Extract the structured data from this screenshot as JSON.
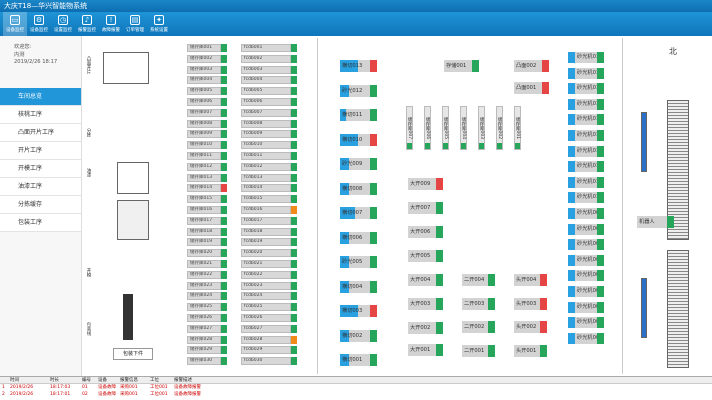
{
  "title": "大庆T18—华兴智能物系统",
  "toolbar": [
    {
      "label": "设备监控",
      "icon": "monitor-icon",
      "active": true
    },
    {
      "label": "设备监控",
      "icon": "gear-icon"
    },
    {
      "label": "设置监控",
      "icon": "clock-icon"
    },
    {
      "label": "报警监控",
      "icon": "bell-icon"
    },
    {
      "label": "故障报警",
      "icon": "alert-icon"
    },
    {
      "label": "订单管理",
      "icon": "document-icon"
    },
    {
      "label": "系统设置",
      "icon": "settings-icon"
    }
  ],
  "user": {
    "name_label": "欢迎您:",
    "name": "内测",
    "datetime": "2019/2/26  18:17"
  },
  "menu": [
    "车间总览",
    "核桃工序",
    "凸面开片工序",
    "开片工序",
    "开模工序",
    "油漆工序",
    "分拣缓存",
    "包装工序"
  ],
  "panel1_col1": [
    "储存库001",
    "储存库002",
    "储存库003",
    "储存库004",
    "储存库005",
    "储存库006",
    "储存库007",
    "储存库008",
    "储存库009",
    "储存库010",
    "储存库011",
    "储存库012",
    "储存库013",
    "储存库014",
    "储存库015",
    "储存库016",
    "储存库017",
    "储存库018",
    "储存库019",
    "储存库020",
    "储存库021",
    "储存库022",
    "储存库023",
    "储存库024",
    "储存库025",
    "储存库026",
    "储存库027",
    "储存库028",
    "储存库029",
    "储存库030"
  ],
  "panel1_col1_status": [
    "green",
    "green",
    "green",
    "green",
    "green",
    "green",
    "green",
    "green",
    "green",
    "green",
    "green",
    "green",
    "green",
    "red",
    "green",
    "green",
    "green",
    "green",
    "green",
    "green",
    "green",
    "green",
    "green",
    "green",
    "green",
    "green",
    "green",
    "green",
    "green",
    "green"
  ],
  "panel1_col2": [
    "fcdb001",
    "fcdb002",
    "fcdb003",
    "fcdb004",
    "fcdb005",
    "fcdb006",
    "fcdb007",
    "fcdb008",
    "fcdb009",
    "fcdb010",
    "fcdb011",
    "fcdb012",
    "fcdb013",
    "fcdb014",
    "fcdb015",
    "fcdb016",
    "fcdb017",
    "fcdb018",
    "fcdb019",
    "fcdb020",
    "fcdb021",
    "fcdb022",
    "fcdb023",
    "fcdb024",
    "fcdb025",
    "fcdb026",
    "fcdb027",
    "fcdb028",
    "fcdb029",
    "fcdb030"
  ],
  "panel1_col2_status": [
    "green",
    "green",
    "green",
    "green",
    "green",
    "green",
    "green",
    "green",
    "green",
    "green",
    "green",
    "green",
    "green",
    "green",
    "green",
    "orange",
    "green",
    "green",
    "green",
    "green",
    "green",
    "green",
    "green",
    "green",
    "green",
    "green",
    "green",
    "orange",
    "green",
    "green"
  ],
  "panel1_labels": {
    "bottom": "包装下件",
    "v1": "凸面开片",
    "v2": "分拣",
    "v3": "油漆",
    "v4": "开模",
    "v5": "包装线"
  },
  "panel2_left": [
    {
      "label": "横切013",
      "fill": 0.6,
      "status": "red"
    },
    {
      "label": "砂光012",
      "fill": 0.3,
      "status": "green"
    },
    {
      "label": "横切011",
      "fill": 0.2,
      "status": "green"
    },
    {
      "label": "横切010",
      "fill": 0.6,
      "status": "red"
    },
    {
      "label": "砂光009",
      "fill": 0.3,
      "status": "green"
    },
    {
      "label": "横切008",
      "fill": 0.3,
      "status": "green"
    },
    {
      "label": "横切007",
      "fill": 0.5,
      "status": "green"
    },
    {
      "label": "横切006",
      "fill": 0.3,
      "status": "green"
    },
    {
      "label": "砂光005",
      "fill": 0.3,
      "status": "green"
    },
    {
      "label": "横切004",
      "fill": 0.3,
      "status": "green"
    },
    {
      "label": "横切003",
      "fill": 0.6,
      "status": "red"
    },
    {
      "label": "横切002",
      "fill": 0.3,
      "status": "green"
    },
    {
      "label": "横切001",
      "fill": 0.3,
      "status": "green"
    }
  ],
  "panel2_top": [
    {
      "label": "存储001",
      "status": "green"
    },
    {
      "label": "凸面002",
      "status": "red"
    },
    {
      "label": "凸面001",
      "status": "red"
    }
  ],
  "panel2_vert": [
    "储存库007",
    "储存库006",
    "储存库005",
    "储存库004",
    "储存库003",
    "储存库002",
    "储存库001"
  ],
  "panel2_mid": [
    {
      "label": "大开009",
      "status": "red"
    },
    {
      "label": "大开007",
      "status": "green"
    },
    {
      "label": "大开006",
      "status": "green"
    },
    {
      "label": "大开005",
      "status": "green"
    },
    {
      "label": "大开004",
      "status": "green"
    },
    {
      "label": "大开003",
      "status": "green"
    },
    {
      "label": "大开002",
      "status": "green"
    },
    {
      "label": "大开001",
      "status": "green"
    }
  ],
  "panel2_mid2": [
    {
      "label": "二开004",
      "status": "green"
    },
    {
      "label": "二开003",
      "status": "green"
    },
    {
      "label": "二开002",
      "status": "green"
    },
    {
      "label": "二开001",
      "status": "green"
    }
  ],
  "panel2_mid3": [
    {
      "label": "头开004",
      "status": "red"
    },
    {
      "label": "头开003",
      "status": "red"
    },
    {
      "label": "头开002",
      "status": "red"
    },
    {
      "label": "头开001",
      "status": "green"
    }
  ],
  "panel2_right": [
    "砂光机019",
    "砂光机018",
    "砂光机017",
    "砂光机016",
    "砂光机015",
    "砂光机014",
    "砂光机013",
    "砂光机012",
    "砂光机011",
    "砂光机010",
    "砂光机009",
    "砂光机008",
    "砂光机007",
    "砂光机006",
    "砂光机005",
    "砂光机004",
    "砂光机003",
    "砂光机002",
    "砂光机001"
  ],
  "panel3": {
    "north": "北",
    "label": "机器人"
  },
  "status_headers": [
    "",
    "时间",
    "时长",
    "编号",
    "设备",
    "报警信息",
    "工位",
    "报警描述"
  ],
  "status_rows": [
    [
      "1",
      "2019/2/26",
      "18:17:03",
      "01",
      "设备故障",
      "采购001",
      "工位001",
      "设备故障报警"
    ],
    [
      "2",
      "2019/2/26",
      "18:17:01",
      "02",
      "设备故障",
      "采购001",
      "工位001",
      "设备故障报警"
    ]
  ]
}
